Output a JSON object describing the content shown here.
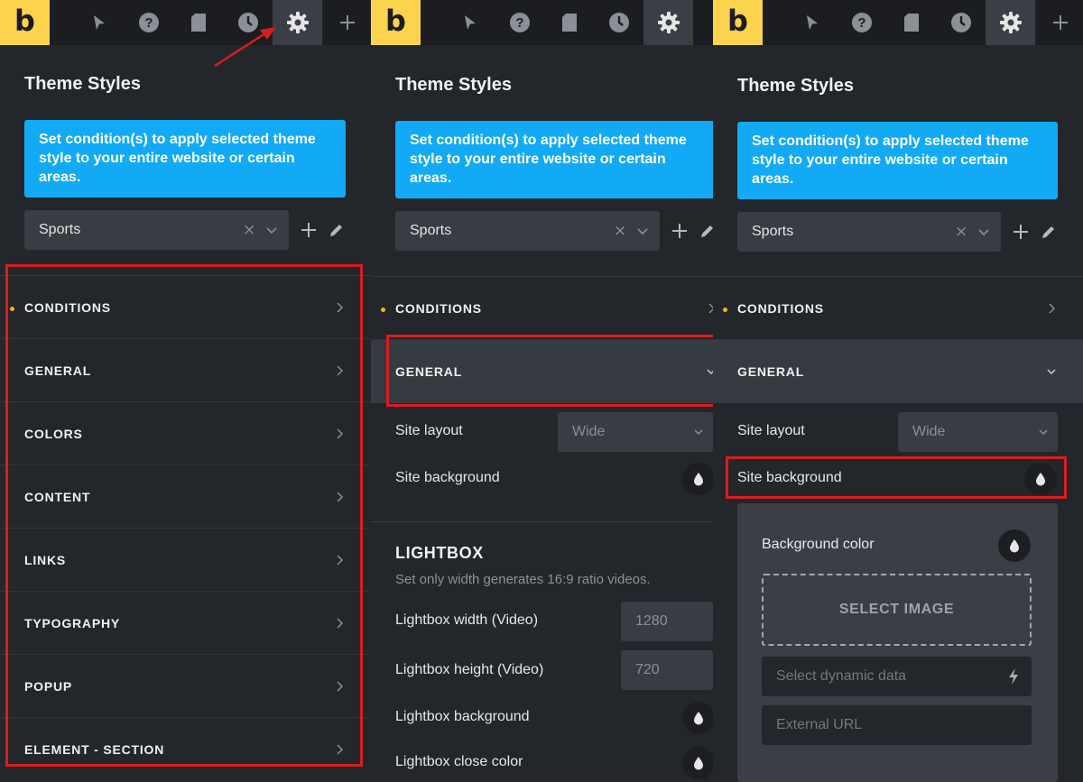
{
  "brand": {
    "logo_letter": "b",
    "logo_color": "#fcd34d",
    "accent_info": "#12aaf5",
    "highlight_red": "#d81e1e",
    "dot_color": "#f5b60b"
  },
  "toolbar": {
    "icons": [
      "logo",
      "pointer-icon",
      "help-icon",
      "page-icon",
      "history-icon",
      "settings-icon",
      "plus-icon"
    ],
    "active": "settings-icon"
  },
  "panels": [
    {
      "title": "Theme Styles",
      "info": "Set condition(s) to apply selected theme style to your entire website or certain areas.",
      "style_select": {
        "value": "Sports",
        "clear": "×"
      },
      "sections": [
        {
          "label": "CONDITIONS",
          "marked": true
        },
        {
          "label": "GENERAL"
        },
        {
          "label": "COLORS"
        },
        {
          "label": "CONTENT"
        },
        {
          "label": "LINKS"
        },
        {
          "label": "TYPOGRAPHY"
        },
        {
          "label": "POPUP"
        },
        {
          "label": "ELEMENT - SECTION"
        }
      ]
    },
    {
      "title": "Theme Styles",
      "info": "Set condition(s) to apply selected theme style to your entire website or certain areas.",
      "style_select": {
        "value": "Sports",
        "clear": "×"
      },
      "sections": [
        {
          "label": "CONDITIONS",
          "marked": true
        },
        {
          "label": "GENERAL",
          "expanded": true
        }
      ],
      "general": {
        "site_layout_label": "Site layout",
        "site_layout_value": "Wide",
        "site_background_label": "Site background"
      },
      "lightbox": {
        "title": "LIGHTBOX",
        "description": "Set only width generates 16:9 ratio videos.",
        "width_label": "Lightbox width (Video)",
        "width_value": "1280",
        "height_label": "Lightbox height (Video)",
        "height_value": "720",
        "background_label": "Lightbox background",
        "close_color_label": "Lightbox close color"
      }
    },
    {
      "title": "Theme Styles",
      "info": "Set condition(s) to apply selected theme style to your entire website or certain areas.",
      "style_select": {
        "value": "Sports",
        "clear": "×"
      },
      "sections": [
        {
          "label": "CONDITIONS",
          "marked": true
        },
        {
          "label": "GENERAL",
          "expanded": true
        }
      ],
      "general": {
        "site_layout_label": "Site layout",
        "site_layout_value": "Wide",
        "site_background_label": "Site background"
      },
      "background_popup": {
        "background_color_label": "Background color",
        "select_image_label": "SELECT IMAGE",
        "dynamic_data_placeholder": "Select dynamic data",
        "external_url_placeholder": "External URL"
      }
    }
  ]
}
